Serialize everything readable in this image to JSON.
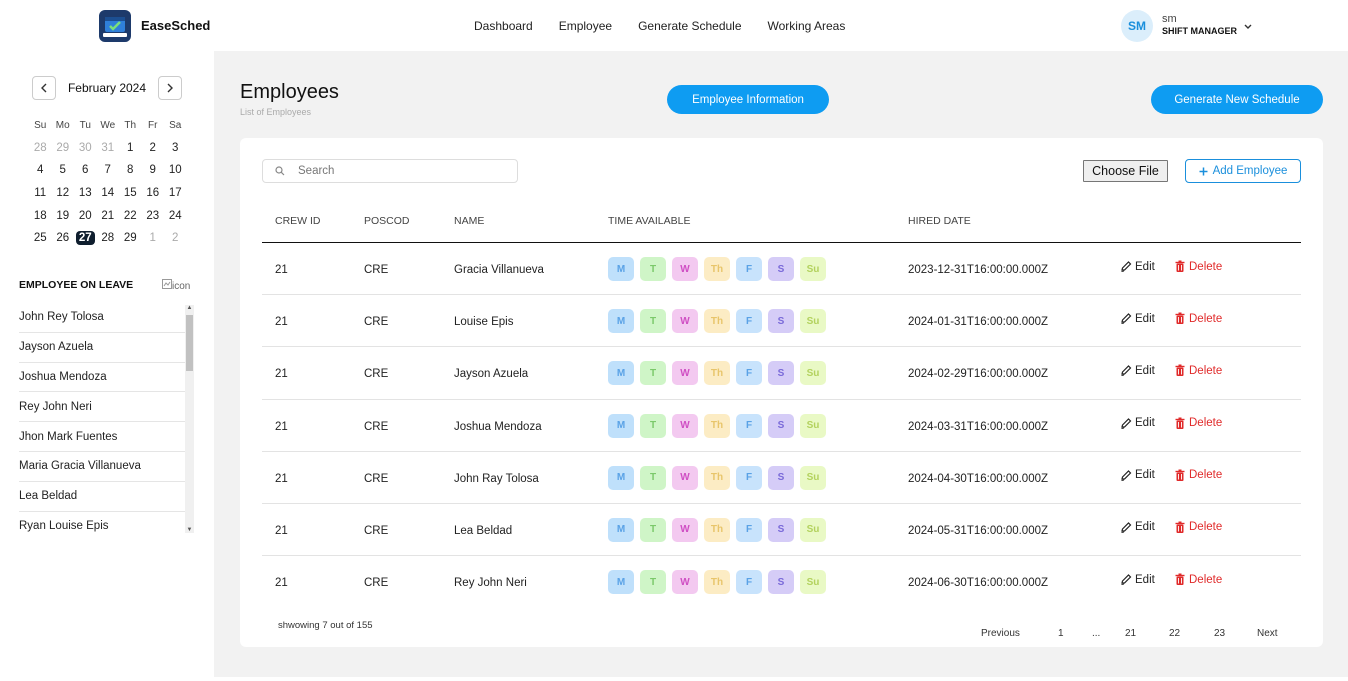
{
  "brand": {
    "name": "EaseSched",
    "logo_text": "EaseSched"
  },
  "nav": [
    "Dashboard",
    "Employee",
    "Generate Schedule",
    "Working Areas"
  ],
  "user": {
    "initials": "SM",
    "name": "sm",
    "role": "SHIFT MANAGER"
  },
  "calendar": {
    "month": "February 2024",
    "weekdays": [
      "Su",
      "Mo",
      "Tu",
      "We",
      "Th",
      "Fr",
      "Sa"
    ],
    "weeks": [
      [
        "28",
        "29",
        "30",
        "31",
        "1",
        "2",
        "3"
      ],
      [
        "4",
        "5",
        "6",
        "7",
        "8",
        "9",
        "10"
      ],
      [
        "11",
        "12",
        "13",
        "14",
        "15",
        "16",
        "17"
      ],
      [
        "18",
        "19",
        "20",
        "21",
        "22",
        "23",
        "24"
      ],
      [
        "25",
        "26",
        "27",
        "28",
        "29",
        "1",
        "2"
      ]
    ],
    "selected": "27"
  },
  "leave": {
    "title": "EMPLOYEE ON LEAVE",
    "icon_alt": "icon",
    "items": [
      "John Rey Tolosa",
      "Jayson Azuela",
      "Joshua Mendoza",
      "Rey John Neri",
      "Jhon Mark Fuentes",
      "Maria Gracia Villanueva",
      "Lea Beldad",
      "Ryan Louise Epis"
    ]
  },
  "page": {
    "title": "Employees",
    "subtitle": "List of Employees",
    "info_button": "Employee Information",
    "generate_button": "Generate New Schedule",
    "search_placeholder": "Search",
    "choose_file": "Choose File",
    "add_employee": "Add Employee"
  },
  "table": {
    "headers": [
      "CREW ID",
      "POSCOD",
      "NAME",
      "TIME AVAILABLE",
      "HIRED DATE"
    ],
    "days": [
      {
        "label": "M",
        "bg": "#bfe0fb",
        "fg": "#5aa2e6"
      },
      {
        "label": "T",
        "bg": "#cff5c7",
        "fg": "#7bc96a"
      },
      {
        "label": "W",
        "bg": "#f3c9f0",
        "fg": "#d04fc4"
      },
      {
        "label": "Th",
        "bg": "#fcecc4",
        "fg": "#e8c56a"
      },
      {
        "label": "F",
        "bg": "#c8e3fc",
        "fg": "#5aa2e6"
      },
      {
        "label": "S",
        "bg": "#d5ccf7",
        "fg": "#7a6ad9"
      },
      {
        "label": "Su",
        "bg": "#e9f9c5",
        "fg": "#b3d25e"
      }
    ],
    "edit_label": "Edit",
    "delete_label": "Delete",
    "rows": [
      {
        "crew_id": "21",
        "poscod": "CRE",
        "name": "Gracia Villanueva",
        "hired": "2023-12-31T16:00:00.000Z"
      },
      {
        "crew_id": "21",
        "poscod": "CRE",
        "name": "Louise Epis",
        "hired": "2024-01-31T16:00:00.000Z"
      },
      {
        "crew_id": "21",
        "poscod": "CRE",
        "name": "Jayson Azuela",
        "hired": "2024-02-29T16:00:00.000Z"
      },
      {
        "crew_id": "21",
        "poscod": "CRE",
        "name": "Joshua Mendoza",
        "hired": "2024-03-31T16:00:00.000Z"
      },
      {
        "crew_id": "21",
        "poscod": "CRE",
        "name": "John Ray Tolosa",
        "hired": "2024-04-30T16:00:00.000Z"
      },
      {
        "crew_id": "21",
        "poscod": "CRE",
        "name": "Lea Beldad",
        "hired": "2024-05-31T16:00:00.000Z"
      },
      {
        "crew_id": "21",
        "poscod": "CRE",
        "name": "Rey John Neri",
        "hired": "2024-06-30T16:00:00.000Z"
      }
    ]
  },
  "footer": {
    "showing": "shwowing 7 out of 155",
    "pagination": [
      "Previous",
      "1",
      "...",
      "21",
      "22",
      "23",
      "Next"
    ]
  },
  "colors": {
    "accent": "#0e9cf2",
    "delete": "#e02a2a",
    "main_bg": "#f2f2f2"
  }
}
